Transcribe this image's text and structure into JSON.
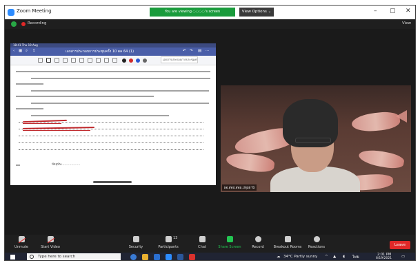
{
  "window": {
    "title": "Zoom Meeting",
    "viewing_banner": "You are viewing ◌◌◌◌'s screen",
    "view_options": "View Options ⌄",
    "min": "–",
    "max": "▢",
    "close": "✕"
  },
  "topbar": {
    "recording_label": "Recording",
    "view_label": "View"
  },
  "share": {
    "tablet_time": "18:41  Thu 19 Aug",
    "doc_title": "เอกสารประกอบการประชุมครั้ง 10 ตค 64 (1)",
    "page_tab": "เอกสารประกอบการประชุมครั้ง",
    "blank_text": "ปัจจุบัน..................."
  },
  "video": {
    "participant_name": "ผอ.สพป.สพม.ปทุมธานี"
  },
  "controls": {
    "unmute": "Unmute",
    "start_video": "Start Video",
    "security": "Security",
    "participants": "Participants",
    "participants_count": "13",
    "chat": "Chat",
    "share_screen": "Share Screen",
    "record": "Record",
    "breakout": "Breakout Rooms",
    "reactions": "Reactions",
    "leave": "Leave"
  },
  "taskbar": {
    "search_placeholder": "Type here to search",
    "weather": "34°C  Partly sunny",
    "time": "2:01 PM",
    "date": "8/19/2021"
  },
  "colors": {
    "zoom_blue": "#2D8CFF",
    "banner_green": "#1a9b3c",
    "leave_red": "#e02828",
    "ink_red": "#c0282c"
  }
}
